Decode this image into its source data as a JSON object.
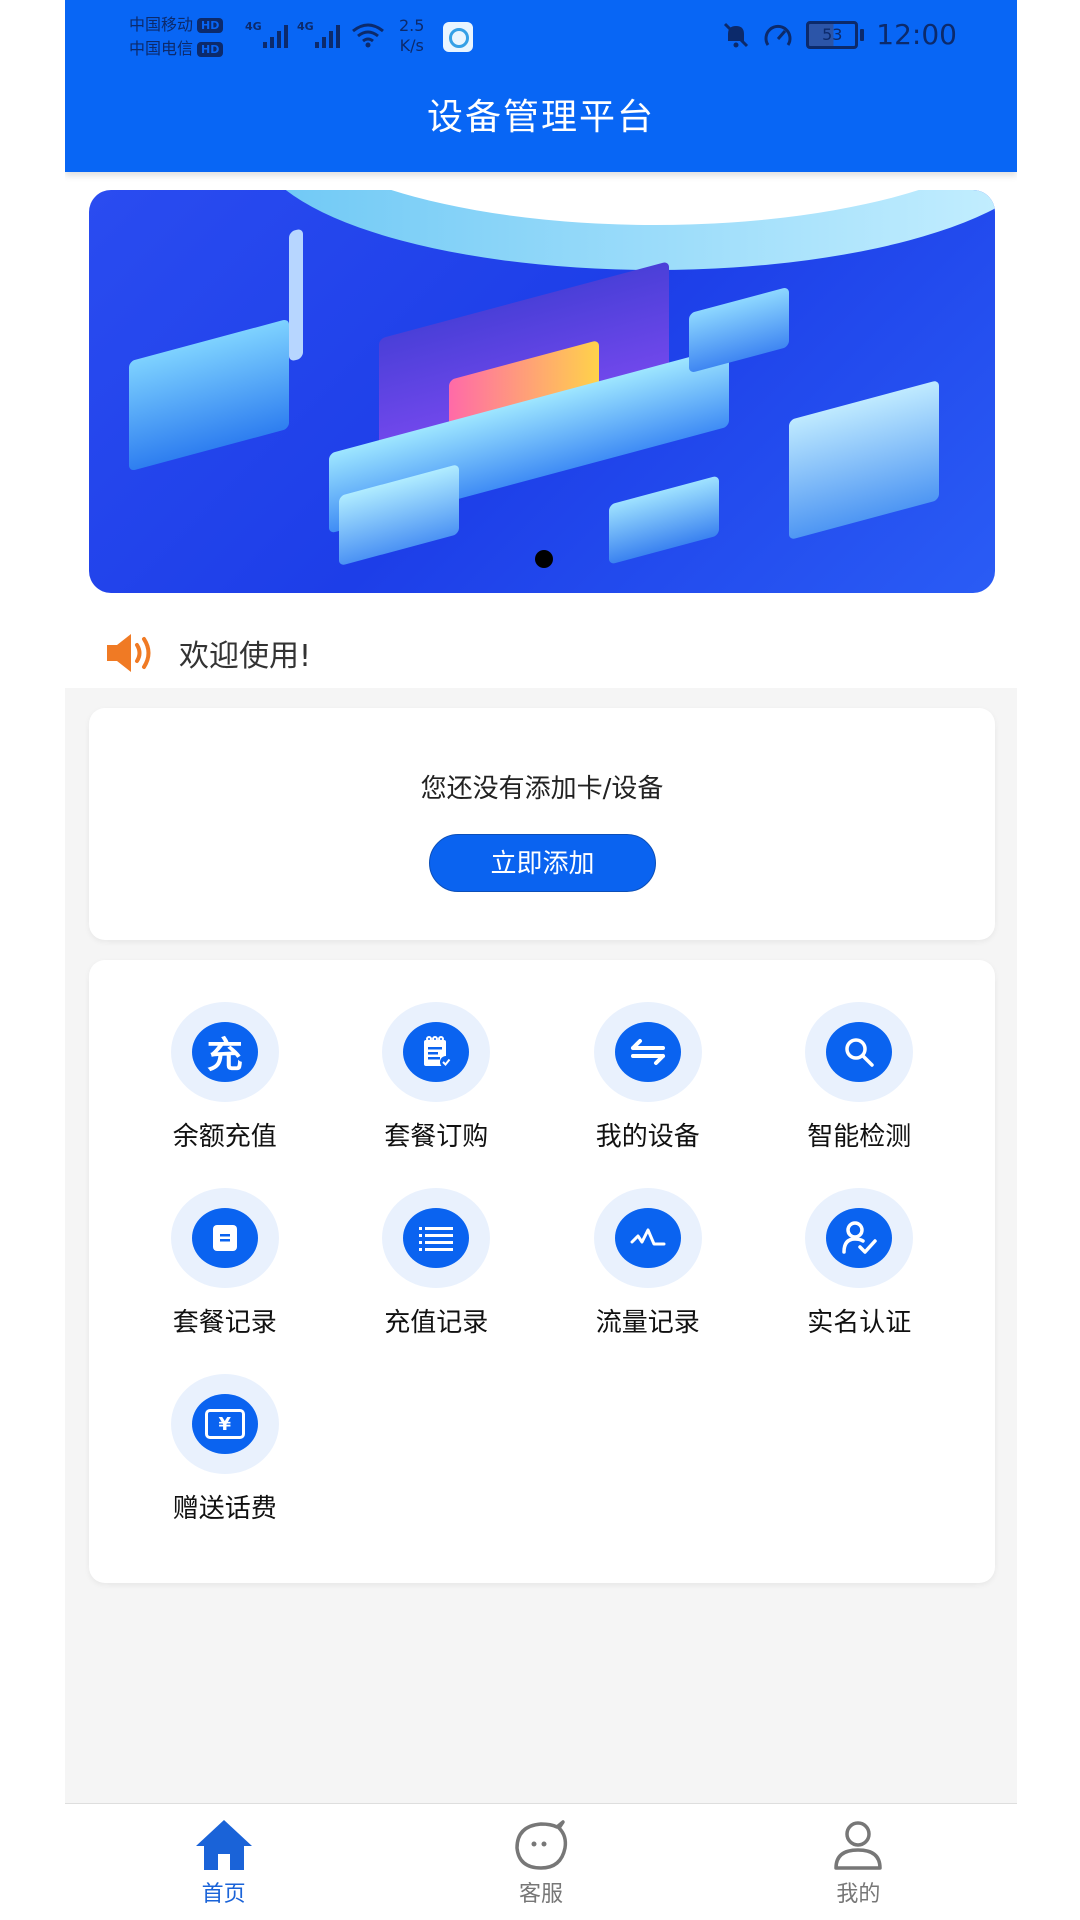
{
  "status_bar": {
    "carrier1": "中国移动",
    "carrier2": "中国电信",
    "hd_badge": "HD",
    "network1": "4G",
    "network2": "4G",
    "speed_value": "2.5",
    "speed_unit": "K/s",
    "battery": "53",
    "time": "12:00"
  },
  "header": {
    "title": "设备管理平台"
  },
  "banner": {
    "slides_total": 1,
    "active_slide": 1
  },
  "notice": {
    "text": "欢迎使用!"
  },
  "device_card": {
    "message": "您还没有添加卡/设备",
    "add_button": "立即添加"
  },
  "menu": {
    "items": [
      {
        "label": "余额充值",
        "icon": "recharge-icon",
        "glyph": "充"
      },
      {
        "label": "套餐订购",
        "icon": "package-order-icon"
      },
      {
        "label": "我的设备",
        "icon": "device-switch-icon"
      },
      {
        "label": "智能检测",
        "icon": "search-icon"
      },
      {
        "label": "套餐记录",
        "icon": "package-record-icon"
      },
      {
        "label": "充值记录",
        "icon": "list-icon"
      },
      {
        "label": "流量记录",
        "icon": "pulse-icon"
      },
      {
        "label": "实名认证",
        "icon": "user-verified-icon"
      },
      {
        "label": "赠送话费",
        "icon": "ticket-yuan-icon",
        "glyph": "¥"
      }
    ]
  },
  "bottom_nav": {
    "tabs": [
      {
        "label": "首页",
        "icon": "home-icon",
        "active": true
      },
      {
        "label": "客服",
        "icon": "chat-face-icon",
        "active": false
      },
      {
        "label": "我的",
        "icon": "user-icon",
        "active": false
      }
    ]
  },
  "colors": {
    "primary": "#0866f5",
    "button": "#0a63f0",
    "icon_bg": "#e9f1fd",
    "notice_icon": "#f07a24",
    "nav_active": "#1a63d8",
    "nav_inactive": "#777777"
  }
}
